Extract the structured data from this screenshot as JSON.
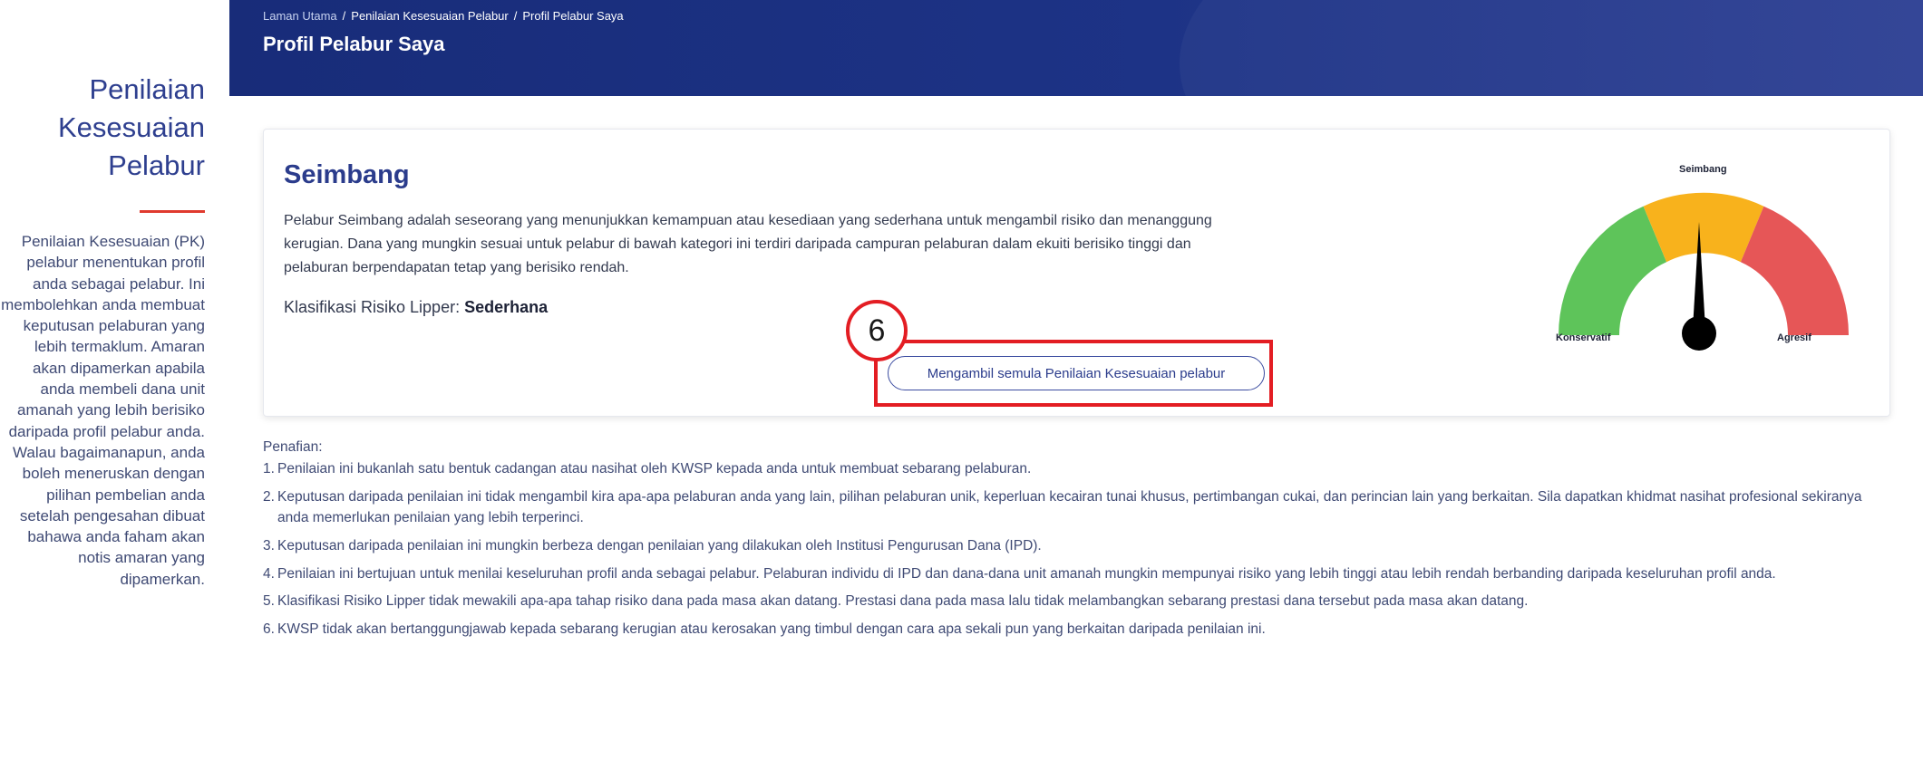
{
  "sidebar": {
    "title": "Penilaian Kesesuaian Pelabur",
    "description": "Penilaian Kesesuaian (PK) pelabur menentukan profil anda sebagai pelabur. Ini membolehkan anda membuat keputusan pelaburan yang lebih termaklum. Amaran akan dipamerkan apabila anda membeli dana unit amanah yang lebih berisiko daripada profil pelabur anda. Walau bagaimanapun, anda boleh meneruskan dengan pilihan pembelian anda setelah pengesahan dibuat bahawa anda faham akan notis amaran yang dipamerkan."
  },
  "header": {
    "breadcrumb": [
      "Laman Utama",
      "Penilaian Kesesuaian Pelabur",
      "Profil Pelabur Saya"
    ],
    "separator": "/",
    "title": "Profil Pelabur Saya"
  },
  "profile": {
    "name": "Seimbang",
    "description": "Pelabur Seimbang adalah seseorang yang menunjukkan kemampuan atau kesediaan yang sederhana untuk mengambil risiko dan menanggung kerugian. Dana yang mungkin sesuai untuk pelabur di bawah kategori ini terdiri daripada campuran pelaburan dalam ekuiti berisiko tinggi dan pelaburan berpendapatan tetap yang berisiko rendah.",
    "risk_label": "Klasifikasi Risiko Lipper: ",
    "risk_value": "Sederhana",
    "retake_label": "Mengambil semula Penilaian Kesesuaian pelabur",
    "step_number": "6"
  },
  "gauge": {
    "label_left": "Konservatif",
    "label_middle": "Seimbang",
    "label_right": "Agresif",
    "selected": "Seimbang",
    "colors": {
      "low": "#5ec45a",
      "mid": "#f8b21c",
      "high": "#e65657",
      "needle": "#000000"
    }
  },
  "disclaimer": {
    "title": "Penafian:",
    "items": [
      "Penilaian ini bukanlah satu bentuk cadangan atau nasihat oleh KWSP kepada anda untuk membuat sebarang pelaburan.",
      "Keputusan daripada penilaian ini tidak mengambil kira apa-apa pelaburan anda yang lain, pilihan pelaburan unik, keperluan kecairan tunai khusus, pertimbangan cukai, dan perincian lain yang berkaitan. Sila dapatkan khidmat nasihat profesional sekiranya anda memerlukan penilaian yang lebih terperinci.",
      "Keputusan daripada penilaian ini mungkin berbeza dengan penilaian yang dilakukan oleh Institusi Pengurusan Dana (IPD).",
      "Penilaian ini bertujuan untuk menilai keseluruhan profil anda sebagai pelabur. Pelaburan individu di IPD dan dana-dana unit amanah mungkin mempunyai risiko yang lebih tinggi atau lebih rendah berbanding daripada keseluruhan profil anda.",
      "Klasifikasi Risiko Lipper tidak mewakili apa-apa tahap risiko dana pada masa akan datang. Prestasi dana pada masa lalu tidak melambangkan sebarang prestasi dana tersebut pada masa akan datang.",
      "KWSP tidak akan bertanggungjawab kepada sebarang kerugian atau kerosakan yang timbul dengan cara apa sekali pun yang berkaitan daripada penilaian ini."
    ]
  }
}
